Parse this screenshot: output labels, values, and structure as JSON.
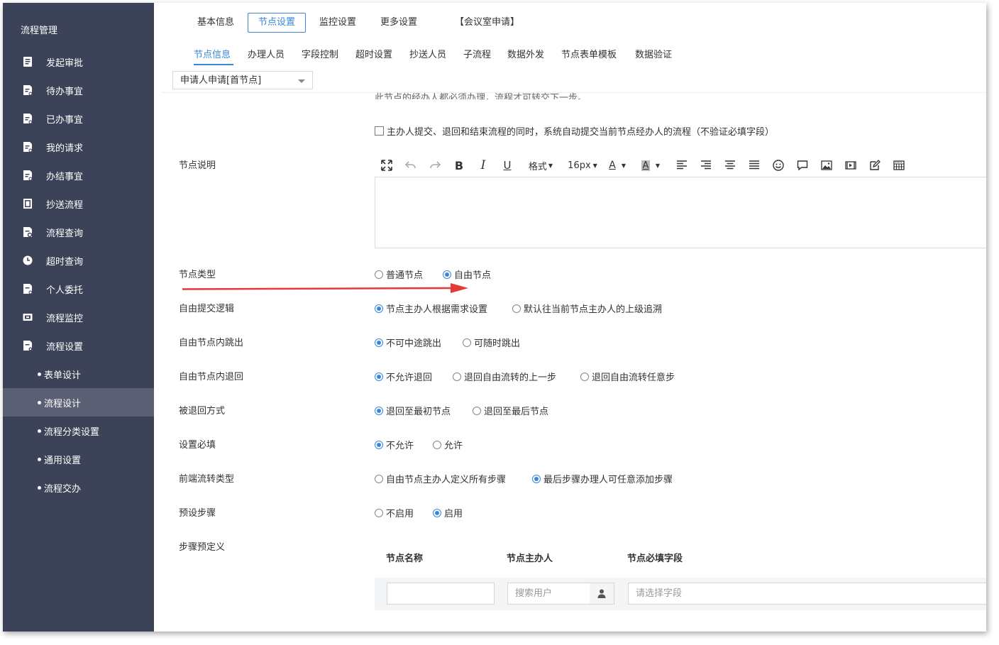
{
  "sidebar": {
    "title": "流程管理",
    "items": [
      {
        "label": "发起审批"
      },
      {
        "label": "待办事宜"
      },
      {
        "label": "已办事宜"
      },
      {
        "label": "我的请求"
      },
      {
        "label": "办结事宜"
      },
      {
        "label": "抄送流程"
      },
      {
        "label": "流程查询"
      },
      {
        "label": "超时查询"
      },
      {
        "label": "个人委托"
      },
      {
        "label": "流程监控"
      },
      {
        "label": "流程设置"
      }
    ],
    "subitems": [
      {
        "label": "表单设计"
      },
      {
        "label": "流程设计",
        "active": true
      },
      {
        "label": "流程分类设置"
      },
      {
        "label": "通用设置"
      },
      {
        "label": "流程交办"
      }
    ]
  },
  "top_tabs": [
    {
      "label": "基本信息"
    },
    {
      "label": "节点设置",
      "active": true
    },
    {
      "label": "监控设置"
    },
    {
      "label": "更多设置"
    },
    {
      "label": "【会议室申请】"
    }
  ],
  "sub_tabs": [
    {
      "label": "节点信息",
      "active": true
    },
    {
      "label": "办理人员"
    },
    {
      "label": "字段控制"
    },
    {
      "label": "超时设置"
    },
    {
      "label": "抄送人员"
    },
    {
      "label": "子流程"
    },
    {
      "label": "数据外发"
    },
    {
      "label": "节点表单模板"
    },
    {
      "label": "数据验证"
    }
  ],
  "node_select": {
    "value": "申请人申请[首节点]"
  },
  "cut_text": "此节点的经办人都必须办理，流程才可转交下一步。",
  "auto_submit_checkbox": {
    "label": "主办人提交、退回和结束流程的同时，系统自动提交当前节点经办人的流程（不验证必填字段）",
    "checked": false
  },
  "editor": {
    "label": "节点说明",
    "format_label": "格式",
    "font_size_label": "16px",
    "font_color_label": "A",
    "bg_color_label": "A"
  },
  "fields": {
    "node_type": {
      "label": "节点类型",
      "options": [
        "普通节点",
        "自由节点"
      ],
      "selected": 1
    },
    "free_submit_logic": {
      "label": "自由提交逻辑",
      "options": [
        "节点主办人根据需求设置",
        "默认往当前节点主办人的上级追溯"
      ],
      "selected": 0
    },
    "free_jump_out": {
      "label": "自由节点内跳出",
      "options": [
        "不可中途跳出",
        "可随时跳出"
      ],
      "selected": 0
    },
    "free_return": {
      "label": "自由节点内退回",
      "options": [
        "不允许退回",
        "退回自由流转的上一步",
        "退回自由流转任意步"
      ],
      "selected": 0
    },
    "returned_mode": {
      "label": "被退回方式",
      "options": [
        "退回至最初节点",
        "退回至最后节点"
      ],
      "selected": 0
    },
    "required_setting": {
      "label": "设置必填",
      "options": [
        "不允许",
        "允许"
      ],
      "selected": 0
    },
    "frontend_flow_type": {
      "label": "前端流转类型",
      "options": [
        "自由节点主办人定义所有步骤",
        "最后步骤办理人可任意添加步骤"
      ],
      "selected": 1
    },
    "preset_steps": {
      "label": "预设步骤",
      "options": [
        "不启用",
        "启用"
      ],
      "selected": 1
    }
  },
  "steps": {
    "label": "步骤预定义",
    "columns": [
      "节点名称",
      "节点主办人",
      "节点必填字段"
    ],
    "row": {
      "name_value": "",
      "user_placeholder": "搜索用户",
      "field_placeholder": "请选择字段"
    }
  },
  "colors": {
    "accent": "#3a86d9",
    "sidebar": "#3c4257",
    "arrow": "#e53935"
  }
}
